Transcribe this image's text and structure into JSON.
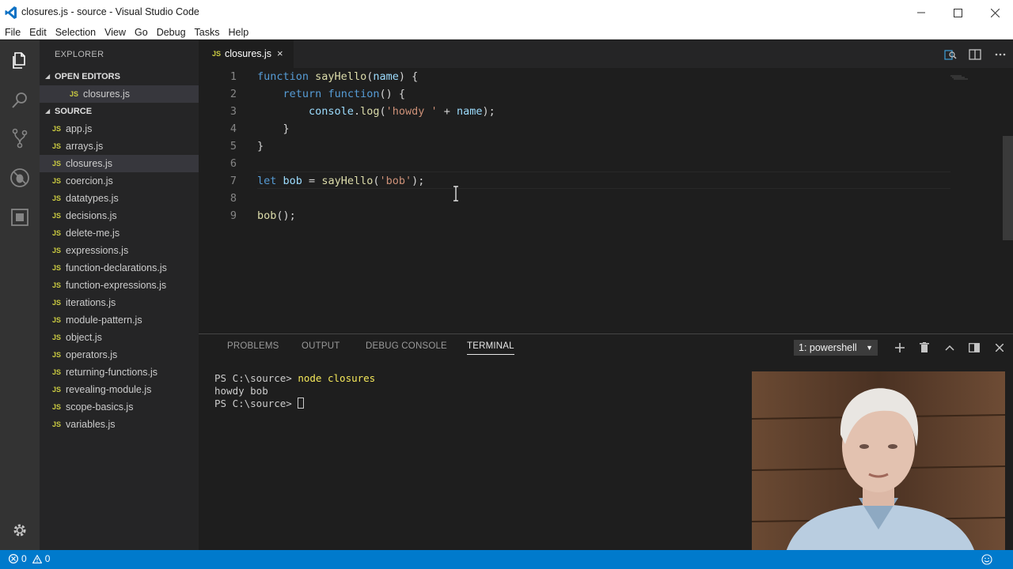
{
  "window": {
    "title": "closures.js - source - Visual Studio Code",
    "controls": [
      "minimize",
      "maximize",
      "close"
    ]
  },
  "menu": [
    "File",
    "Edit",
    "Selection",
    "View",
    "Go",
    "Debug",
    "Tasks",
    "Help"
  ],
  "activity_bar": [
    "explorer-icon",
    "search-icon",
    "source-control-icon",
    "debug-icon",
    "extensions-icon",
    "gear-icon"
  ],
  "sidebar": {
    "header": "EXPLORER",
    "open_editors": {
      "label": "OPEN EDITORS",
      "items": [
        {
          "badge": "JS",
          "name": "closures.js"
        }
      ]
    },
    "folder": {
      "label": "SOURCE",
      "files": [
        {
          "badge": "JS",
          "name": "app.js"
        },
        {
          "badge": "JS",
          "name": "arrays.js"
        },
        {
          "badge": "JS",
          "name": "closures.js"
        },
        {
          "badge": "JS",
          "name": "coercion.js"
        },
        {
          "badge": "JS",
          "name": "datatypes.js"
        },
        {
          "badge": "JS",
          "name": "decisions.js"
        },
        {
          "badge": "JS",
          "name": "delete-me.js"
        },
        {
          "badge": "JS",
          "name": "expressions.js"
        },
        {
          "badge": "JS",
          "name": "function-declarations.js"
        },
        {
          "badge": "JS",
          "name": "function-expressions.js"
        },
        {
          "badge": "JS",
          "name": "iterations.js"
        },
        {
          "badge": "JS",
          "name": "module-pattern.js"
        },
        {
          "badge": "JS",
          "name": "object.js"
        },
        {
          "badge": "JS",
          "name": "operators.js"
        },
        {
          "badge": "JS",
          "name": "returning-functions.js"
        },
        {
          "badge": "JS",
          "name": "revealing-module.js"
        },
        {
          "badge": "JS",
          "name": "scope-basics.js"
        },
        {
          "badge": "JS",
          "name": "variables.js"
        }
      ],
      "selected": "closures.js"
    }
  },
  "editor": {
    "tab": {
      "badge": "JS",
      "name": "closures.js",
      "close": "×"
    },
    "lines": [
      {
        "n": "1",
        "tokens": [
          [
            "kw",
            "function"
          ],
          [
            "pun",
            " "
          ],
          [
            "fn",
            "sayHello"
          ],
          [
            "pun",
            "("
          ],
          [
            "var",
            "name"
          ],
          [
            "pun",
            ") {"
          ]
        ]
      },
      {
        "n": "2",
        "tokens": [
          [
            "pun",
            "    "
          ],
          [
            "kw",
            "return"
          ],
          [
            "pun",
            " "
          ],
          [
            "kw",
            "function"
          ],
          [
            "pun",
            "() {"
          ]
        ]
      },
      {
        "n": "3",
        "tokens": [
          [
            "pun",
            "        "
          ],
          [
            "var",
            "console"
          ],
          [
            "pun",
            "."
          ],
          [
            "fn",
            "log"
          ],
          [
            "pun",
            "("
          ],
          [
            "str",
            "'howdy '"
          ],
          [
            "pun",
            " + "
          ],
          [
            "var",
            "name"
          ],
          [
            "pun",
            ");"
          ]
        ]
      },
      {
        "n": "4",
        "tokens": [
          [
            "pun",
            "    }"
          ]
        ]
      },
      {
        "n": "5",
        "tokens": [
          [
            "pun",
            "}"
          ]
        ]
      },
      {
        "n": "6",
        "tokens": []
      },
      {
        "n": "7",
        "tokens": [
          [
            "kw",
            "let"
          ],
          [
            "pun",
            " "
          ],
          [
            "var",
            "bob"
          ],
          [
            "pun",
            " = "
          ],
          [
            "fn",
            "sayHello"
          ],
          [
            "pun",
            "("
          ],
          [
            "str",
            "'bob'"
          ],
          [
            "pun",
            ");"
          ]
        ]
      },
      {
        "n": "8",
        "tokens": []
      },
      {
        "n": "9",
        "tokens": [
          [
            "fn",
            "bob"
          ],
          [
            "pun",
            "();"
          ]
        ]
      }
    ]
  },
  "panel": {
    "tabs": [
      "PROBLEMS",
      "OUTPUT",
      "DEBUG CONSOLE",
      "TERMINAL"
    ],
    "active_tab": "TERMINAL",
    "shell": "1: powershell",
    "actions": [
      "add-icon",
      "trash-icon",
      "chevron-up-icon",
      "split-icon",
      "close-icon"
    ],
    "terminal": [
      {
        "prompt": "PS C:\\source> ",
        "cmd": "node closures"
      },
      {
        "prompt": "howdy bob",
        "cmd": ""
      },
      {
        "prompt": "PS C:\\source> ",
        "cmd": "",
        "cursor": true
      }
    ]
  },
  "statusbar": {
    "errors": "0",
    "warnings": "0"
  },
  "colors": {
    "statusbar": "#007acc",
    "keyword": "#569cd6",
    "function": "#dcdcaa",
    "variable": "#9cdcfe",
    "string": "#ce9178"
  }
}
